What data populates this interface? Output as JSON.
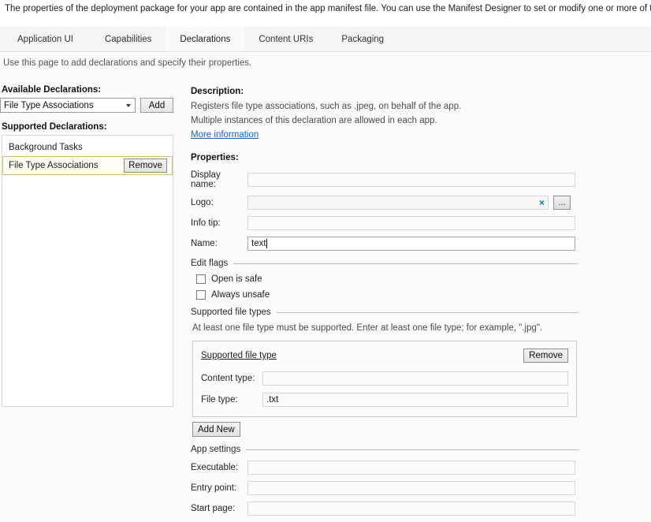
{
  "intro": {
    "text": "The properties of the deployment package for your app are contained in the app manifest file. You can use the Manifest Designer to set or modify one or more of the properties."
  },
  "tabs": [
    {
      "label": "Application UI",
      "active": false
    },
    {
      "label": "Capabilities",
      "active": false
    },
    {
      "label": "Declarations",
      "active": true
    },
    {
      "label": "Content URIs",
      "active": false
    },
    {
      "label": "Packaging",
      "active": false
    }
  ],
  "page_hint": "Use this page to add declarations and specify their properties.",
  "left": {
    "available_label": "Available Declarations:",
    "combo_value": "File Type Associations",
    "add_button": "Add",
    "supported_label": "Supported Declarations:",
    "items": [
      {
        "label": "Background Tasks",
        "selected": false,
        "remove_label": ""
      },
      {
        "label": "File Type Associations",
        "selected": true,
        "remove_label": "Remove"
      }
    ]
  },
  "description": {
    "heading": "Description:",
    "line1": "Registers file type associations, such as .jpeg, on behalf of the app.",
    "line2": "Multiple instances of this declaration are allowed in each app.",
    "link": "More information"
  },
  "properties": {
    "heading": "Properties:",
    "display_name": {
      "label": "Display name:",
      "value": "",
      "placeholder": ""
    },
    "logo": {
      "label": "Logo:",
      "value": "",
      "placeholder": "",
      "clear_icon": "×",
      "browse_label": "..."
    },
    "info_tip": {
      "label": "Info tip:",
      "value": "",
      "placeholder": ""
    },
    "name": {
      "label": "Name:",
      "value": "text",
      "placeholder": ""
    }
  },
  "edit_flags": {
    "group_label": "Edit flags",
    "open_is_safe": {
      "label": "Open is safe",
      "checked": false
    },
    "always_unsafe": {
      "label": "Always unsafe",
      "checked": false
    }
  },
  "supported_file_types": {
    "group_label": "Supported file types",
    "hint": "At least one file type must be supported. Enter at least one file type; for example, \".jpg\".",
    "panel_title": "Supported file type",
    "panel_remove": "Remove",
    "content_type": {
      "label": "Content type:",
      "value": "",
      "placeholder": ""
    },
    "file_type": {
      "label": "File type:",
      "value": ".txt",
      "placeholder": ""
    },
    "add_new": "Add New"
  },
  "app_settings": {
    "group_label": "App settings",
    "executable": {
      "label": "Executable:",
      "value": "",
      "placeholder": ""
    },
    "entry_point": {
      "label": "Entry point:",
      "value": "",
      "placeholder": ""
    },
    "start_page": {
      "label": "Start page:",
      "value": "",
      "placeholder": ""
    }
  },
  "colors": {
    "accent_link": "#1565c0",
    "selection_border": "#d9bb6a",
    "tab_strip_bg": "#f4f4f4"
  }
}
